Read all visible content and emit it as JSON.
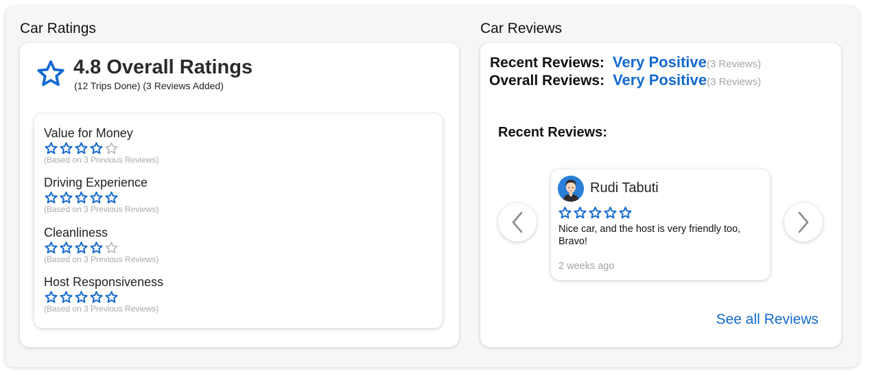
{
  "colors": {
    "accent": "#1469cf",
    "empty_star": "#b5b5b5",
    "muted_text": "#a9a9a9"
  },
  "car_ratings": {
    "title": "Car Ratings",
    "overall_icon": "star-outline-icon",
    "overall_title": "4.8 Overall Ratings",
    "overall_subtitle": "(12 Trips Done) (3 Reviews Added)",
    "categories": [
      {
        "name": "Value for Money",
        "rating": 4,
        "max": 5,
        "note": "(Based on 3 Previous Reviews)"
      },
      {
        "name": "Driving Experience",
        "rating": 5,
        "max": 5,
        "note": "(Based on 3 Previous Reviews)"
      },
      {
        "name": "Cleanliness",
        "rating": 4,
        "max": 5,
        "note": "(Based on 3 Previous Reviews)"
      },
      {
        "name": "Host Responsiveness",
        "rating": 5,
        "max": 5,
        "note": "(Based on 3 Previous Reviews)"
      }
    ]
  },
  "car_reviews": {
    "title": "Car Reviews",
    "recent_summary": {
      "label": "Recent Reviews:",
      "value": "Very Positive",
      "count": "(3 Reviews)"
    },
    "overall_summary": {
      "label": "Overall Reviews:",
      "value": "Very Positive",
      "count": "(3 Reviews)"
    },
    "recent_heading": "Recent Reviews:",
    "prev_icon": "chevron-left-icon",
    "next_icon": "chevron-right-icon",
    "review": {
      "reviewer": "Rudi Tabuti",
      "rating": 5,
      "max": 5,
      "text": "Nice car, and the host is very friendly too, Bravo!",
      "time": "2 weeks ago"
    },
    "see_all": "See all Reviews"
  }
}
